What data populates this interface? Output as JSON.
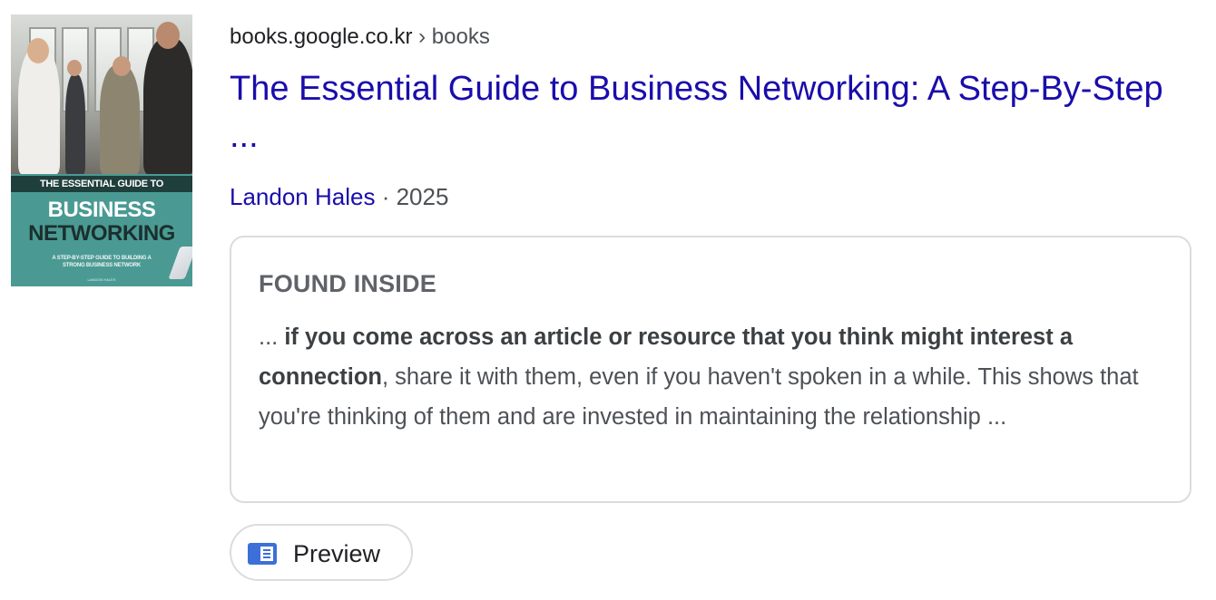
{
  "result": {
    "url": {
      "domain": "books.google.co.kr",
      "separator": " › ",
      "path": "books"
    },
    "title": "The Essential Guide to Business Networking: A Step-By-Step ...",
    "author": "Landon Hales",
    "year_separator": " · ",
    "year": "2025",
    "cover": {
      "band_text": "THE ESSENTIAL GUIDE TO",
      "line1": "BUSINESS",
      "line2": "NETWORKING",
      "subtitle1": "A STEP-BY-STEP GUIDE TO BUILDING A",
      "subtitle2": "STRONG BUSINESS NETWORK",
      "author_small": "LANDON HALES"
    },
    "found_inside": {
      "label": "FOUND INSIDE",
      "prefix": "... ",
      "bold": "if you come across an article or resource that you think might interest a connection",
      "rest": ", share it with them, even if you haven't spoken in a while. This shows that you're thinking of them and are invested in maintaining the relationship ..."
    },
    "preview_button": {
      "label": "Preview",
      "icon": "book-preview-icon"
    }
  },
  "colors": {
    "link": "#1a0dab",
    "text": "#4d5156",
    "border": "#dadce0",
    "cover_teal": "#4a9a93",
    "preview_icon": "#3c6fd8"
  }
}
